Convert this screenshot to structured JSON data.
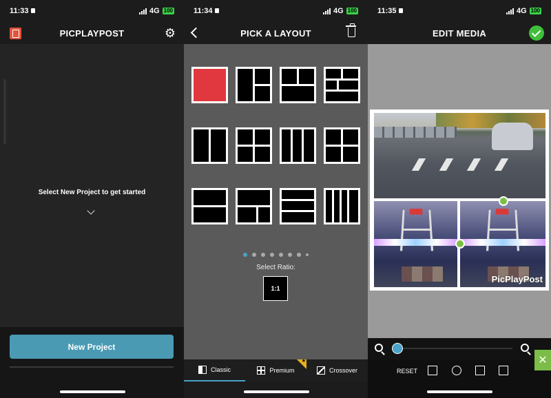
{
  "screen1": {
    "status": {
      "time": "11:33",
      "network": "4G",
      "battery": "100"
    },
    "app_title": "PICPLAYPOST",
    "hint": "Select New Project to get started",
    "new_project_label": "New Project"
  },
  "screen2": {
    "status": {
      "time": "11:34",
      "network": "4G",
      "battery": "100"
    },
    "title": "PICK A LAYOUT",
    "ratio_label": "Select Ratio:",
    "ratio_value": "1:1",
    "page_dots": {
      "total": 8,
      "active": 1
    },
    "tabs": [
      {
        "label": "Classic",
        "icon": "classic-layout-icon",
        "active": true
      },
      {
        "label": "Premium",
        "icon": "premium-grid-icon",
        "active": false
      },
      {
        "label": "Crossover",
        "icon": "crossover-icon",
        "active": false
      }
    ],
    "accent": "#4aa3c9",
    "selected_color": "#e0383e"
  },
  "screen3": {
    "status": {
      "time": "11:35",
      "network": "4G",
      "battery": "100"
    },
    "title": "EDIT MEDIA",
    "watermark": "PicPlayPost",
    "reset_label": "RESET",
    "zoom_level": 0.0,
    "confirm_color": "#3fbf3a"
  }
}
